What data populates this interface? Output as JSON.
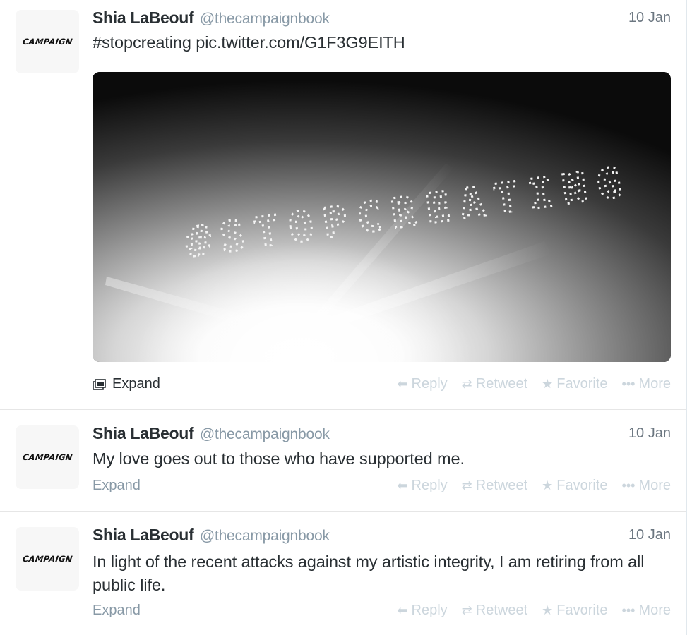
{
  "tweets": [
    {
      "avatar_text": "CAMPAIGN",
      "fullname": "Shia LaBeouf",
      "username": "@thecampaignbook",
      "time": "10 Jan",
      "text": "#stopcreating pic.twitter.com/G1F3G9EITH",
      "media_caption": "#STOPCREATING",
      "expand_label": "Expand"
    },
    {
      "avatar_text": "CAMPAIGN",
      "fullname": "Shia LaBeouf",
      "username": "@thecampaignbook",
      "time": "10 Jan",
      "text": "My love goes out to those who have supported me.",
      "expand_label": "Expand"
    },
    {
      "avatar_text": "CAMPAIGN",
      "fullname": "Shia LaBeouf",
      "username": "@thecampaignbook",
      "time": "10 Jan",
      "text": "In light of the recent attacks against my artistic integrity, I am retiring from all public life.",
      "expand_label": "Expand"
    }
  ],
  "actions": {
    "reply": "Reply",
    "retweet": "Retweet",
    "favorite": "Favorite",
    "more": "More"
  },
  "icons": {
    "reply": "reply-arrow-icon",
    "retweet": "retweet-icon",
    "favorite": "star-icon",
    "more": "ellipsis-icon",
    "expand_media": "media-icon"
  }
}
